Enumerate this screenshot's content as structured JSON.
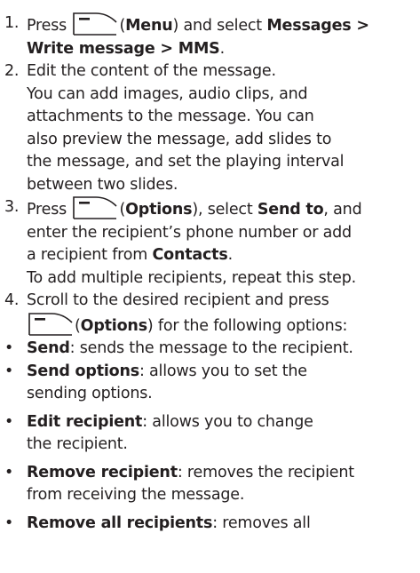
{
  "steps": [
    {
      "num": "1.",
      "press": "Press",
      "key_label": "Menu",
      "mid": "and select",
      "bold_path": "Messages >",
      "line2_bold": "Write message > MMS",
      "line2_end": "."
    },
    {
      "num": "2.",
      "line1": "Edit the content of the message.",
      "lines": [
        "You can add images, audio clips, and",
        "attachments to the message. You can",
        "also preview the message, add slides to",
        "the message, and set the playing interval",
        "between two slides."
      ]
    },
    {
      "num": "3.",
      "press": "Press",
      "key_label": "Options",
      "mid": "), select",
      "bold1": "Send to",
      "end1": ", and",
      "line2": "enter the recipient’s phone number or add",
      "line3_pre": "a recipient from",
      "line3_bold": "Contacts",
      "line3_end": ".",
      "line4": "To add multiple recipients, repeat this step."
    },
    {
      "num": "4.",
      "line1": "Scroll to the desired recipient and press",
      "key_label": "Options",
      "line2_end": ") for the following options:"
    }
  ],
  "bullets": [
    {
      "term": "Send",
      "lines": [
        ": sends the message to the recipient."
      ]
    },
    {
      "term": "Send options",
      "lines": [
        ": allows you to set the",
        "sending options."
      ]
    },
    {
      "term": "Edit recipient",
      "lines": [
        ": allows you to change",
        "the recipient."
      ]
    },
    {
      "term": "Remove recipient",
      "lines": [
        ": removes the recipient",
        "from receiving the message."
      ]
    },
    {
      "term": "Remove all recipients",
      "lines": [
        ": removes all"
      ]
    }
  ],
  "bullet_char": "•",
  "icon": "softkey-menu-icon"
}
